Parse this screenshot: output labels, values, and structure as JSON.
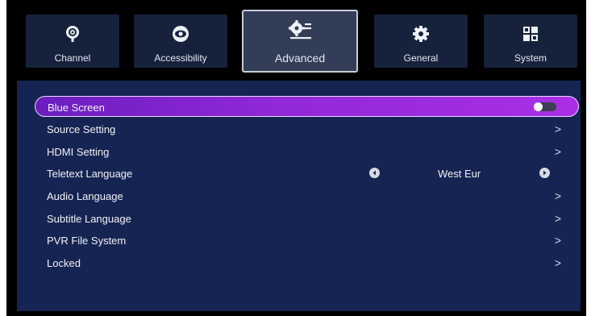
{
  "tabs": [
    {
      "label": "Channel",
      "icon": "satellite-dish-icon"
    },
    {
      "label": "Accessibility",
      "icon": "eye-icon"
    },
    {
      "label": "Advanced",
      "icon": "gear-list-icon",
      "active": true
    },
    {
      "label": "General",
      "icon": "gear-icon"
    },
    {
      "label": "System",
      "icon": "grid-icon"
    }
  ],
  "settings": [
    {
      "label": "Blue Screen",
      "control": "toggle",
      "toggle_on": false,
      "selected": true
    },
    {
      "label": "Source Setting",
      "control": "chevron"
    },
    {
      "label": "HDMI Setting",
      "control": "chevron"
    },
    {
      "label": "Teletext Language",
      "control": "selector",
      "value": "West Eur"
    },
    {
      "label": "Audio Language",
      "control": "chevron"
    },
    {
      "label": "Subtitle Language",
      "control": "chevron"
    },
    {
      "label": "PVR File System",
      "control": "chevron"
    },
    {
      "label": "Locked",
      "control": "chevron"
    }
  ],
  "chevron_glyph": ">",
  "colors": {
    "panel": "#152452",
    "tab": "#16213c",
    "tab_active": "#323d57",
    "highlight": "#9228d9"
  }
}
